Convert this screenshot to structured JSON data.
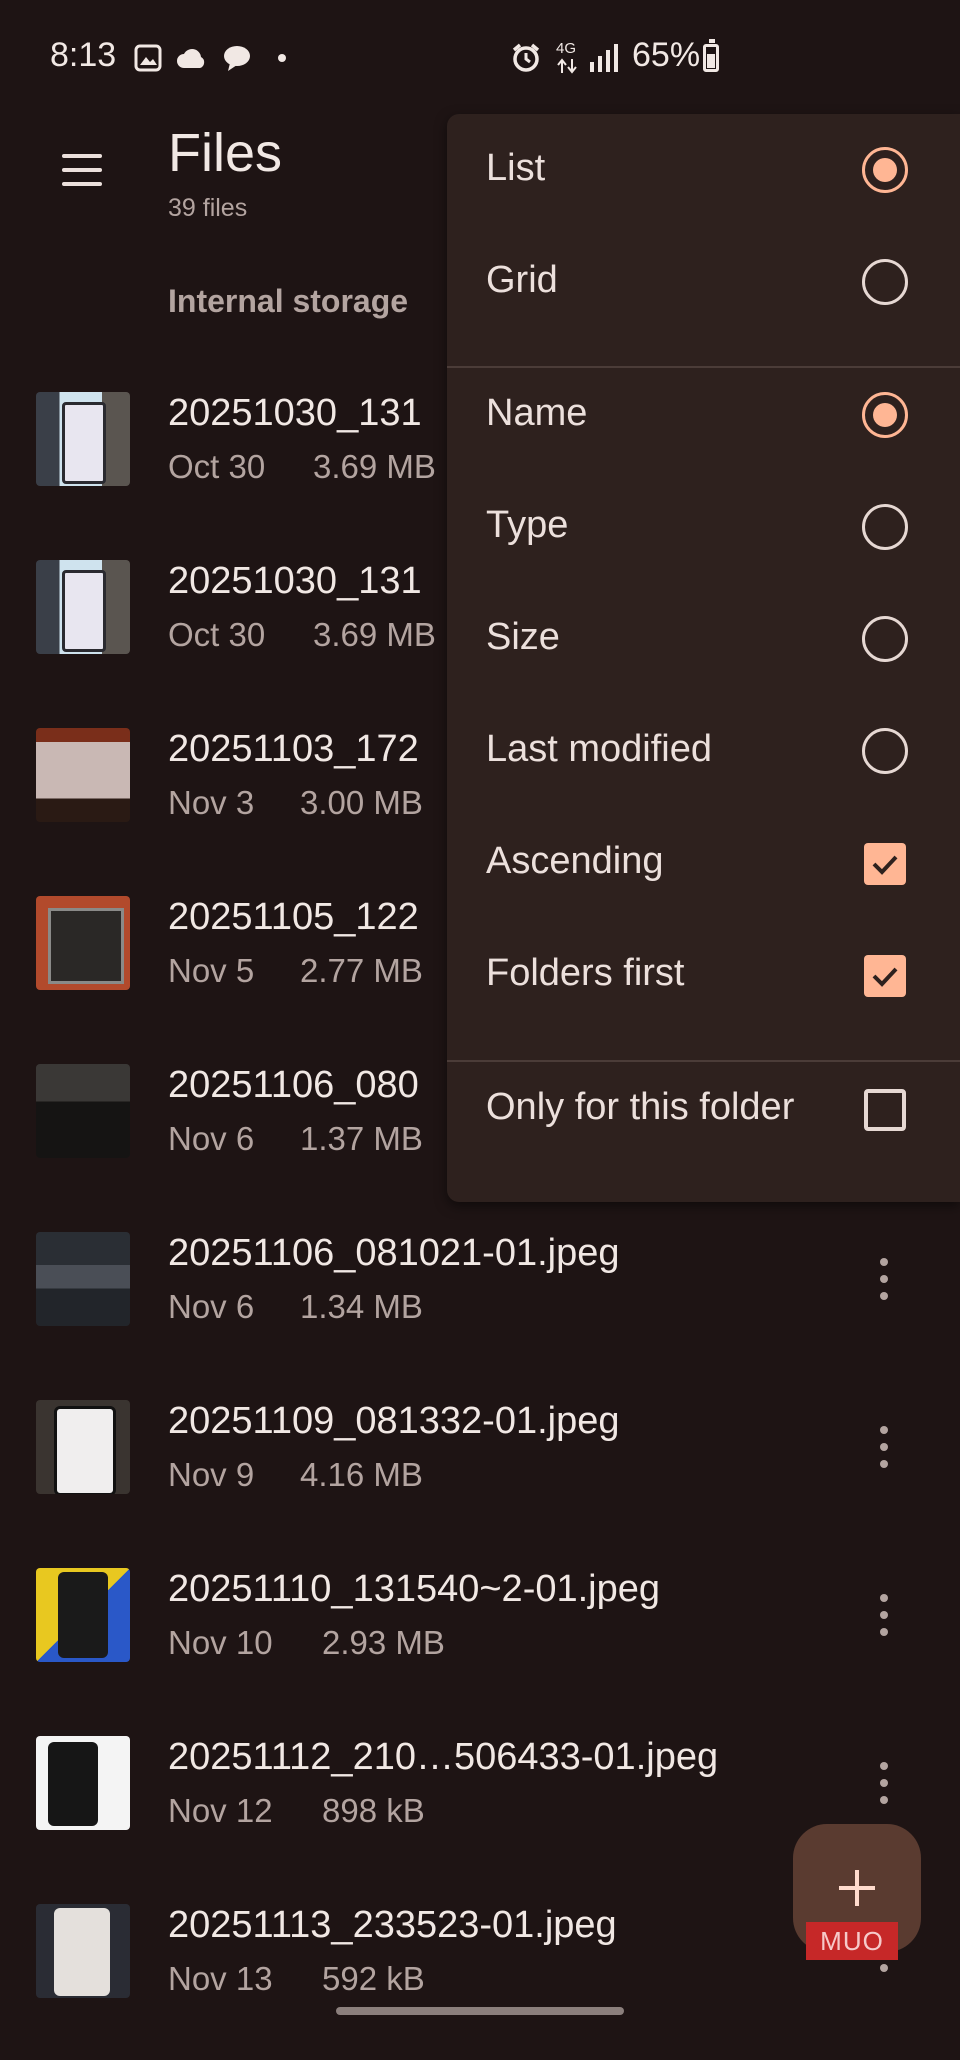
{
  "status_bar": {
    "time": "8:13",
    "battery": "65%",
    "network": "4G"
  },
  "header": {
    "title": "Files",
    "subtitle": "39 files",
    "breadcrumb": "Internal storage"
  },
  "files": [
    {
      "name": "20251030_131",
      "date": "Oct 30",
      "size": "3.69 MB"
    },
    {
      "name": "20251030_131",
      "date": "Oct 30",
      "size": "3.69 MB"
    },
    {
      "name": "20251103_172",
      "date": "Nov 3",
      "size": "3.00 MB"
    },
    {
      "name": "20251105_122",
      "date": "Nov 5",
      "size": "2.77 MB"
    },
    {
      "name": "20251106_080",
      "date": "Nov 6",
      "size": "1.37 MB"
    },
    {
      "name": "20251106_081021-01.jpeg",
      "date": "Nov 6",
      "size": "1.34 MB"
    },
    {
      "name": "20251109_081332-01.jpeg",
      "date": "Nov 9",
      "size": "4.16 MB"
    },
    {
      "name": "20251110_131540~2-01.jpeg",
      "date": "Nov 10",
      "size": "2.93 MB"
    },
    {
      "name": "20251112_210…506433-01.jpeg",
      "date": "Nov 12",
      "size": "898 kB"
    },
    {
      "name": "20251113_233523-01.jpeg",
      "date": "Nov 13",
      "size": "592 kB"
    }
  ],
  "view_menu": {
    "view_list": "List",
    "view_grid": "Grid",
    "sort_name": "Name",
    "sort_type": "Type",
    "sort_size": "Size",
    "sort_last_modified": "Last modified",
    "ascending": "Ascending",
    "folders_first": "Folders first",
    "only_this_folder": "Only for this folder"
  },
  "watermark": "MUO",
  "colors": {
    "background": "#1e1414",
    "menu": "#2e211e",
    "accent": "#ffb694",
    "fab": "#5a3b30"
  }
}
